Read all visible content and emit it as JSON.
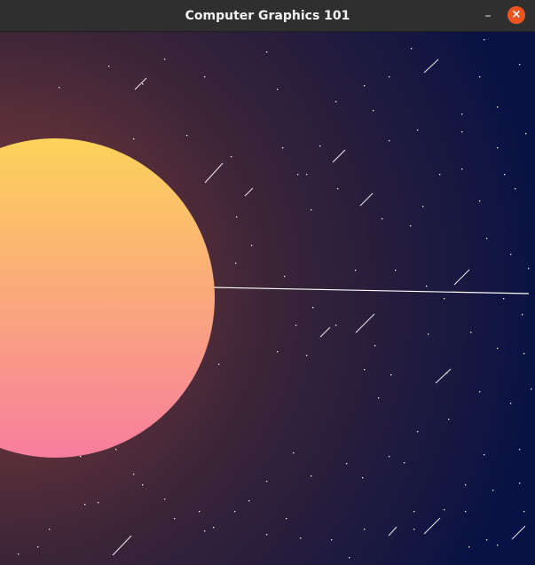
{
  "window": {
    "title": "Computer Graphics 101",
    "minimize_symbol": "–",
    "close_symbol": "×"
  },
  "colors": {
    "sky_glow": "#8a3f3b",
    "sky_mid": "#3a2438",
    "sky_edge": "#081244",
    "sun_top": "#fdd35a",
    "sun_bottom": "#f77d9e",
    "star": "#ffffff",
    "close_button": "#e95420"
  },
  "icons": {
    "minimize": "minimize-icon",
    "close": "close-icon"
  }
}
